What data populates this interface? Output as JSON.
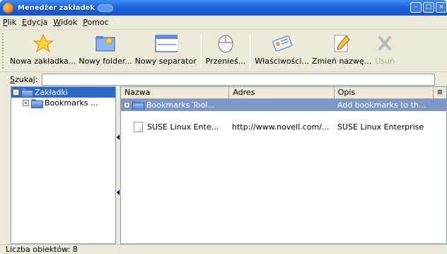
{
  "window": {
    "title": "Menedżer zakładek",
    "buttons": {
      "minimize": "–",
      "maximize": "□",
      "close": "×"
    }
  },
  "menu": [
    "Plik",
    "Edycja",
    "Widok",
    "Pomoc"
  ],
  "toolbar": {
    "new_bookmark": "Nowa zakładka...",
    "new_folder": "Nowy folder...",
    "new_separator": "Nowy separator",
    "move": "Przenieś...",
    "properties": "Właściwości...",
    "rename": "Zmień nazwę...",
    "delete": "Usuń"
  },
  "search": {
    "label": "Szukaj:",
    "value": ""
  },
  "tree": [
    {
      "label": "Zakładki",
      "expander": "-",
      "selected": true
    },
    {
      "label": "Bookmarks ...",
      "expander": "+",
      "selected": false
    }
  ],
  "list": {
    "columns": [
      "Nazwa",
      "Adres",
      "Opis"
    ],
    "columns_picker": "⊞",
    "rows": [
      {
        "name": "Bookmarks Tool...",
        "address": "",
        "description": "Add bookmarks to th...",
        "type": "folder",
        "selected": true
      },
      {
        "name": "",
        "address": "",
        "description": "",
        "type": "separator",
        "selected": false
      },
      {
        "name": "SUSE Linux Ente...",
        "address": "http://www.novell.com/...",
        "description": "SUSE Linux Enterprise",
        "type": "bookmark",
        "selected": false
      }
    ]
  },
  "status": "Liczba obiektów: 8"
}
